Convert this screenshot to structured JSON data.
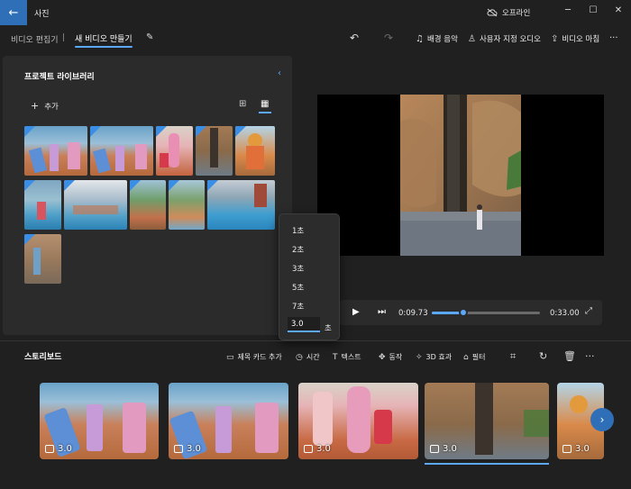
{
  "titlebar": {
    "app_title": "사진",
    "back_icon": "back-arrow-icon",
    "offline_label": "오프라인",
    "minimize": "─",
    "maximize": "☐",
    "close": "✕"
  },
  "toolbar": {
    "breadcrumb_edit": "비디오 편집기",
    "breadcrumb_sep": "|",
    "breadcrumb_new": "새 비디오 만들기",
    "undo": "↶",
    "redo": "↷",
    "bg_music": "배경 음악",
    "custom_audio": "사용자 지정 오디오",
    "finish_video": "비디오 마침",
    "more": "···"
  },
  "library": {
    "title": "프로젝트 라이브러리",
    "add": "추가"
  },
  "player": {
    "current_time": "0:09.73",
    "total_time": "0:33.00",
    "progress": 0.295
  },
  "duration_menu": {
    "options": [
      "1초",
      "2초",
      "3초",
      "5초",
      "7초"
    ],
    "custom_value": "3.0",
    "unit": "초"
  },
  "storyboard": {
    "title": "스토리보드",
    "add_title_card": "제목 카드 추가",
    "duration": "시간",
    "text": "텍스트",
    "motion": "동작",
    "effects_3d": "3D 효과",
    "filters": "필터",
    "more": "···",
    "clips": [
      {
        "duration": "3.0"
      },
      {
        "duration": "3.0"
      },
      {
        "duration": "3.0"
      },
      {
        "duration": "3.0"
      },
      {
        "duration": "3.0"
      }
    ]
  },
  "colors": {
    "accent": "#5aa8ff",
    "back_button": "#2f6fb7",
    "panel": "#2b2b2b",
    "background": "#202020"
  }
}
